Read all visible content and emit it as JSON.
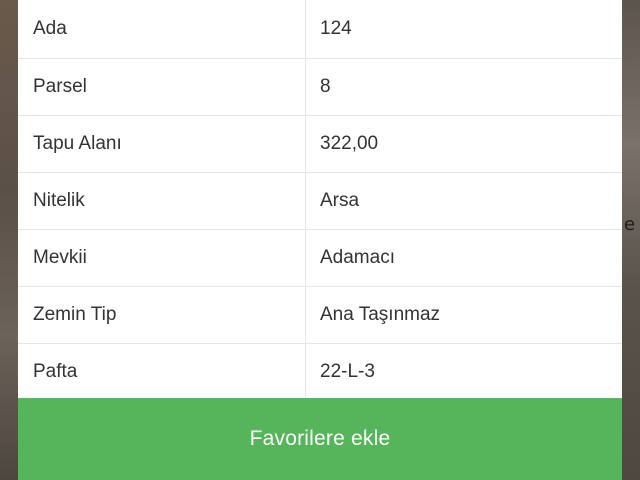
{
  "map_background": {
    "fragment_text": "e"
  },
  "details": {
    "rows": [
      {
        "label": "Ada",
        "value": "124"
      },
      {
        "label": "Parsel",
        "value": "8"
      },
      {
        "label": "Tapu Alanı",
        "value": "322,00"
      },
      {
        "label": "Nitelik",
        "value": "Arsa"
      },
      {
        "label": "Mevkii",
        "value": "Adamacı"
      },
      {
        "label": "Zemin Tip",
        "value": "Ana Taşınmaz"
      },
      {
        "label": "Pafta",
        "value": "22-L-3"
      }
    ]
  },
  "actions": {
    "favorite_label": "Favorilere ekle"
  },
  "colors": {
    "accent_green": "#56b55b",
    "text": "#333333",
    "divider": "#e6e6e6"
  }
}
